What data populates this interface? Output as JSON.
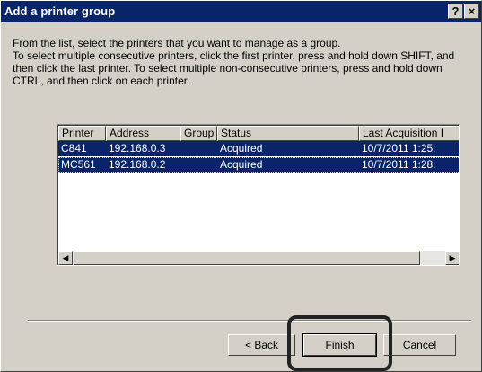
{
  "window": {
    "title": "Add a printer group",
    "help_glyph": "?",
    "close_glyph": "×"
  },
  "instructions": {
    "line1": "From the list, select the printers that you want to manage as a group.",
    "line2": "To select multiple consecutive printers, click the first printer, press and hold down SHIFT, and then click the last printer. To select multiple non-consecutive printers, press and hold down CTRL, and then click on each printer."
  },
  "printer_list": {
    "columns": [
      "Printer",
      "Address",
      "Group",
      "Status",
      "Last Acquisition I"
    ],
    "rows": [
      {
        "printer": "C841",
        "address": "192.168.0.3",
        "group": "",
        "status": "Acquired",
        "last_acquisition": "10/7/2011 1:25:"
      },
      {
        "printer": "MC561",
        "address": "192.168.0.2",
        "group": "",
        "status": "Acquired",
        "last_acquisition": "10/7/2011 1:28:"
      }
    ],
    "scroll_left_glyph": "◀",
    "scroll_right_glyph": "▶"
  },
  "buttons": {
    "back_prefix": "< ",
    "back_mnemonic": "B",
    "back_rest": "ack",
    "finish": "Finish",
    "cancel": "Cancel"
  },
  "colors": {
    "titlebar": "#0a246a",
    "selection": "#0a246a",
    "face": "#d4d0c8"
  }
}
